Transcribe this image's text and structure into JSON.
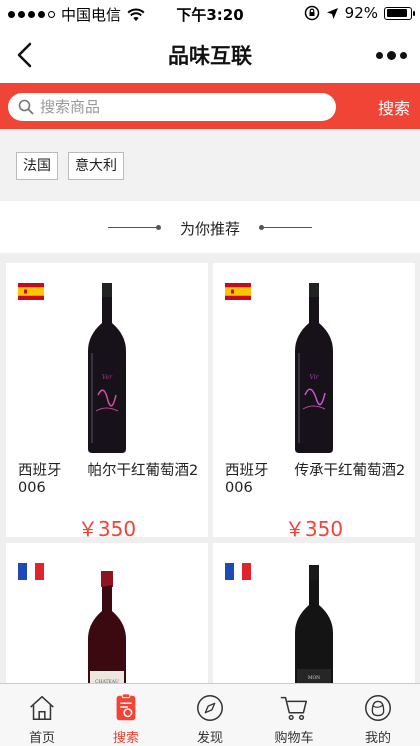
{
  "status_bar": {
    "carrier": "中国电信",
    "time": "下午3:20",
    "battery_text": "92%",
    "battery_level": 0.92
  },
  "nav": {
    "title": "品味互联"
  },
  "search": {
    "placeholder": "搜索商品",
    "button_label": "搜索"
  },
  "filters": [
    {
      "label": "法国"
    },
    {
      "label": "意大利"
    }
  ],
  "recommend": {
    "label": "为你推荐"
  },
  "products": [
    {
      "origin": "西班牙",
      "name": "帕尔干红葡萄酒2006",
      "price": "￥350",
      "flag": "spain-flag"
    },
    {
      "origin": "西班牙",
      "name": "传承干红葡萄酒2006",
      "price": "￥350",
      "flag": "spain-flag"
    },
    {
      "origin": "",
      "name": "",
      "price": "",
      "flag": "france-flag"
    },
    {
      "origin": "",
      "name": "",
      "price": "",
      "flag": "france-flag"
    }
  ],
  "tabbar": {
    "items": [
      {
        "label": "首页",
        "icon": "home-icon"
      },
      {
        "label": "搜索",
        "icon": "search-list-icon"
      },
      {
        "label": "发现",
        "icon": "compass-icon"
      },
      {
        "label": "购物车",
        "icon": "cart-icon"
      },
      {
        "label": "我的",
        "icon": "profile-icon"
      }
    ],
    "active_index": 1,
    "active_color": "#ef4436"
  },
  "colors": {
    "brand": "#ef4436",
    "background": "#efefef"
  }
}
